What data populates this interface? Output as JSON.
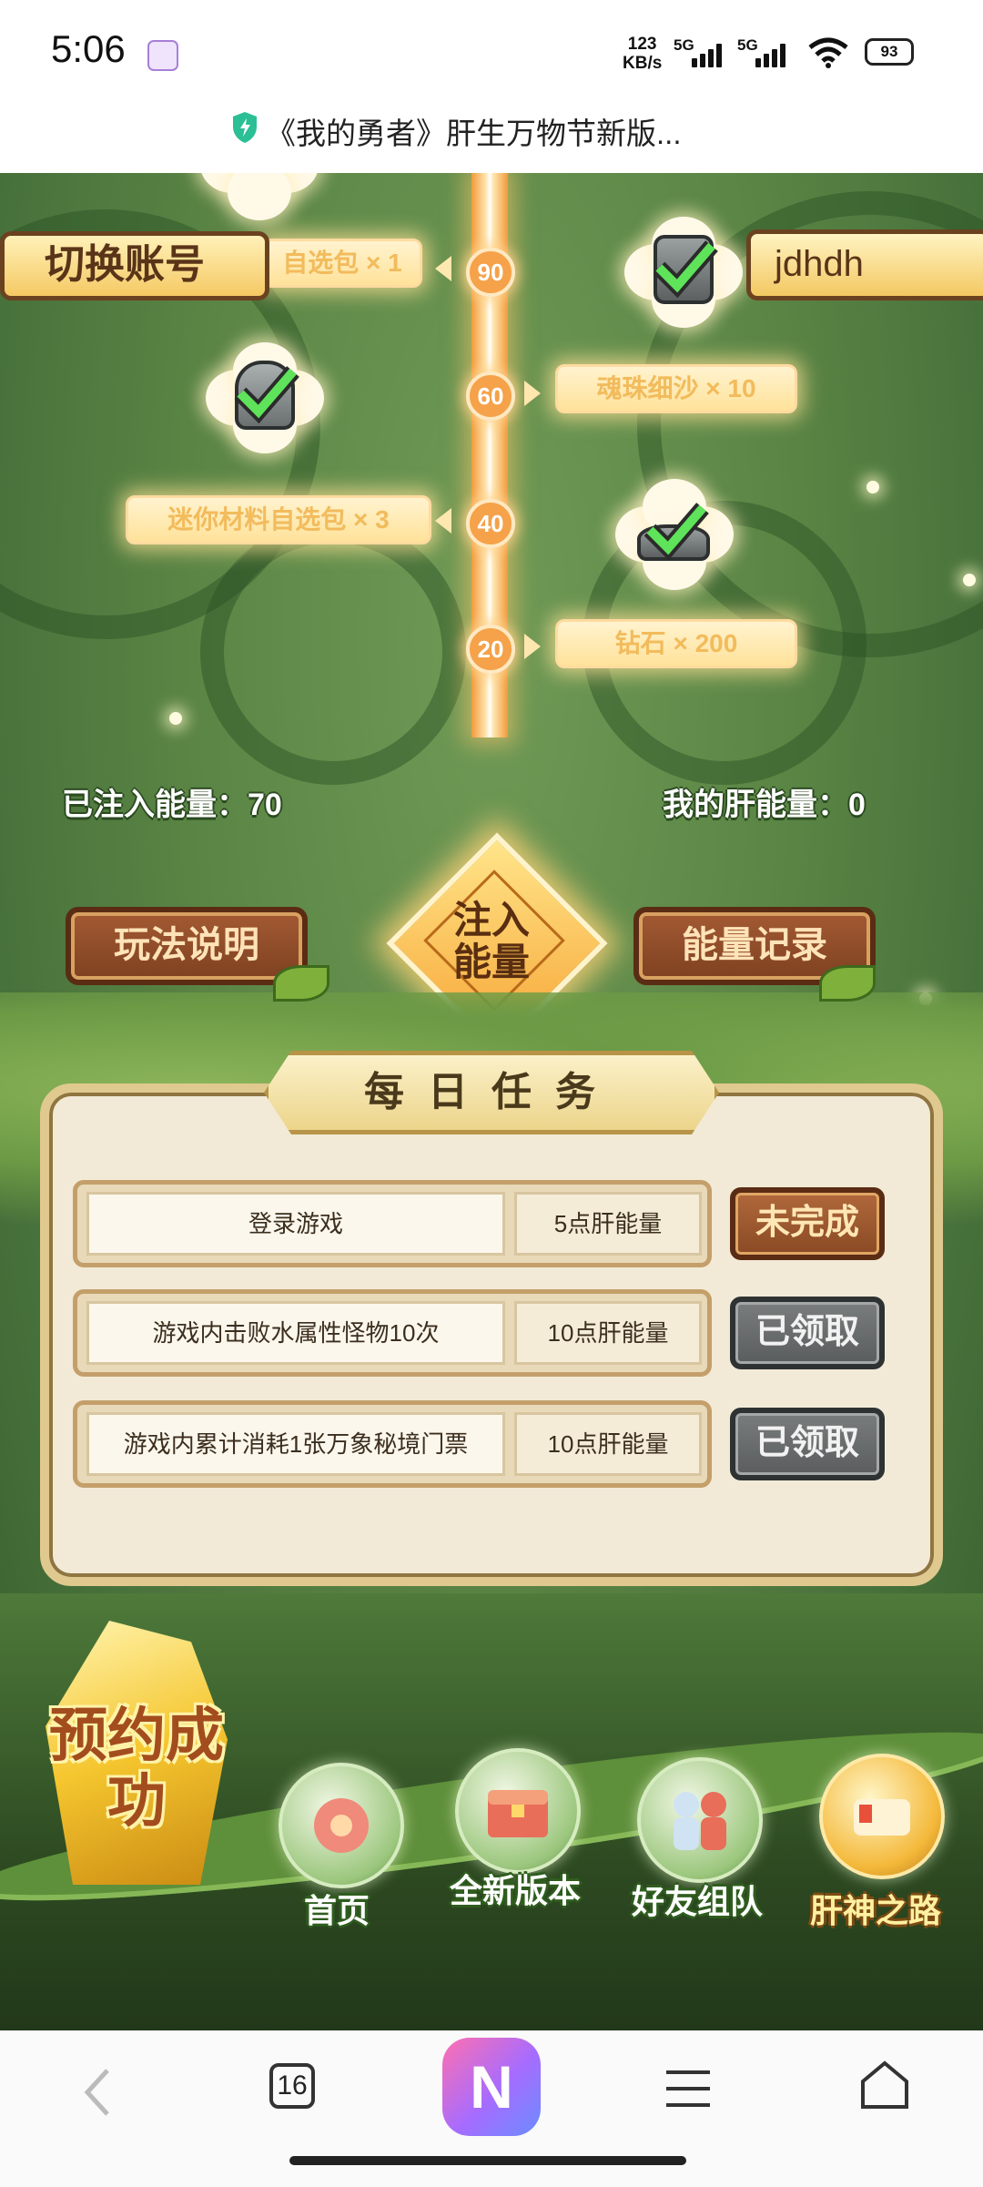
{
  "status_bar": {
    "time": "5:06",
    "net_speed_value": "123",
    "net_speed_unit": "KB/s",
    "sig1": "5G",
    "sig2": "5G",
    "battery": "93"
  },
  "url_bar": {
    "page_title": "《我的勇者》肝生万物节新版..."
  },
  "tree": {
    "top_reward_partial": "自选包 × 1",
    "nodes": [
      "90",
      "60",
      "40",
      "20"
    ],
    "rewards": {
      "r60": "魂珠细沙 × 10",
      "r40": "迷你材料自选包 × 3",
      "r20": "钻石 × 200"
    }
  },
  "account": {
    "switch_label": "切换账号",
    "username": "jdhdh"
  },
  "energy": {
    "injected_label": "已注入能量：70",
    "mine_label": "我的肝能量：0",
    "inject_button": "注入能量"
  },
  "buttons": {
    "rules": "玩法说明",
    "records": "能量记录"
  },
  "daily": {
    "title": "每日任务",
    "tasks": [
      {
        "name": "登录游戏",
        "points": "5点肝能量",
        "status": "未完成"
      },
      {
        "name": "游戏内击败水属性怪物10次",
        "points": "10点肝能量",
        "status": "已领取"
      },
      {
        "name": "游戏内累计消耗1张万象秘境门票",
        "points": "10点肝能量",
        "status": "已领取"
      }
    ]
  },
  "game_nav": {
    "booking": "预约成功",
    "items": [
      "首页",
      "全新版本",
      "好友组队",
      "肝神之路"
    ]
  },
  "browser": {
    "tab_count": "16",
    "center_app": "N"
  },
  "colors": {
    "background_green": "#5a8444",
    "trunk_orange": "#f19a3a",
    "reward_gold": "#f2bb5c",
    "wood_brown": "#8a4a24",
    "claimed_gray": "#5a5d5d"
  }
}
